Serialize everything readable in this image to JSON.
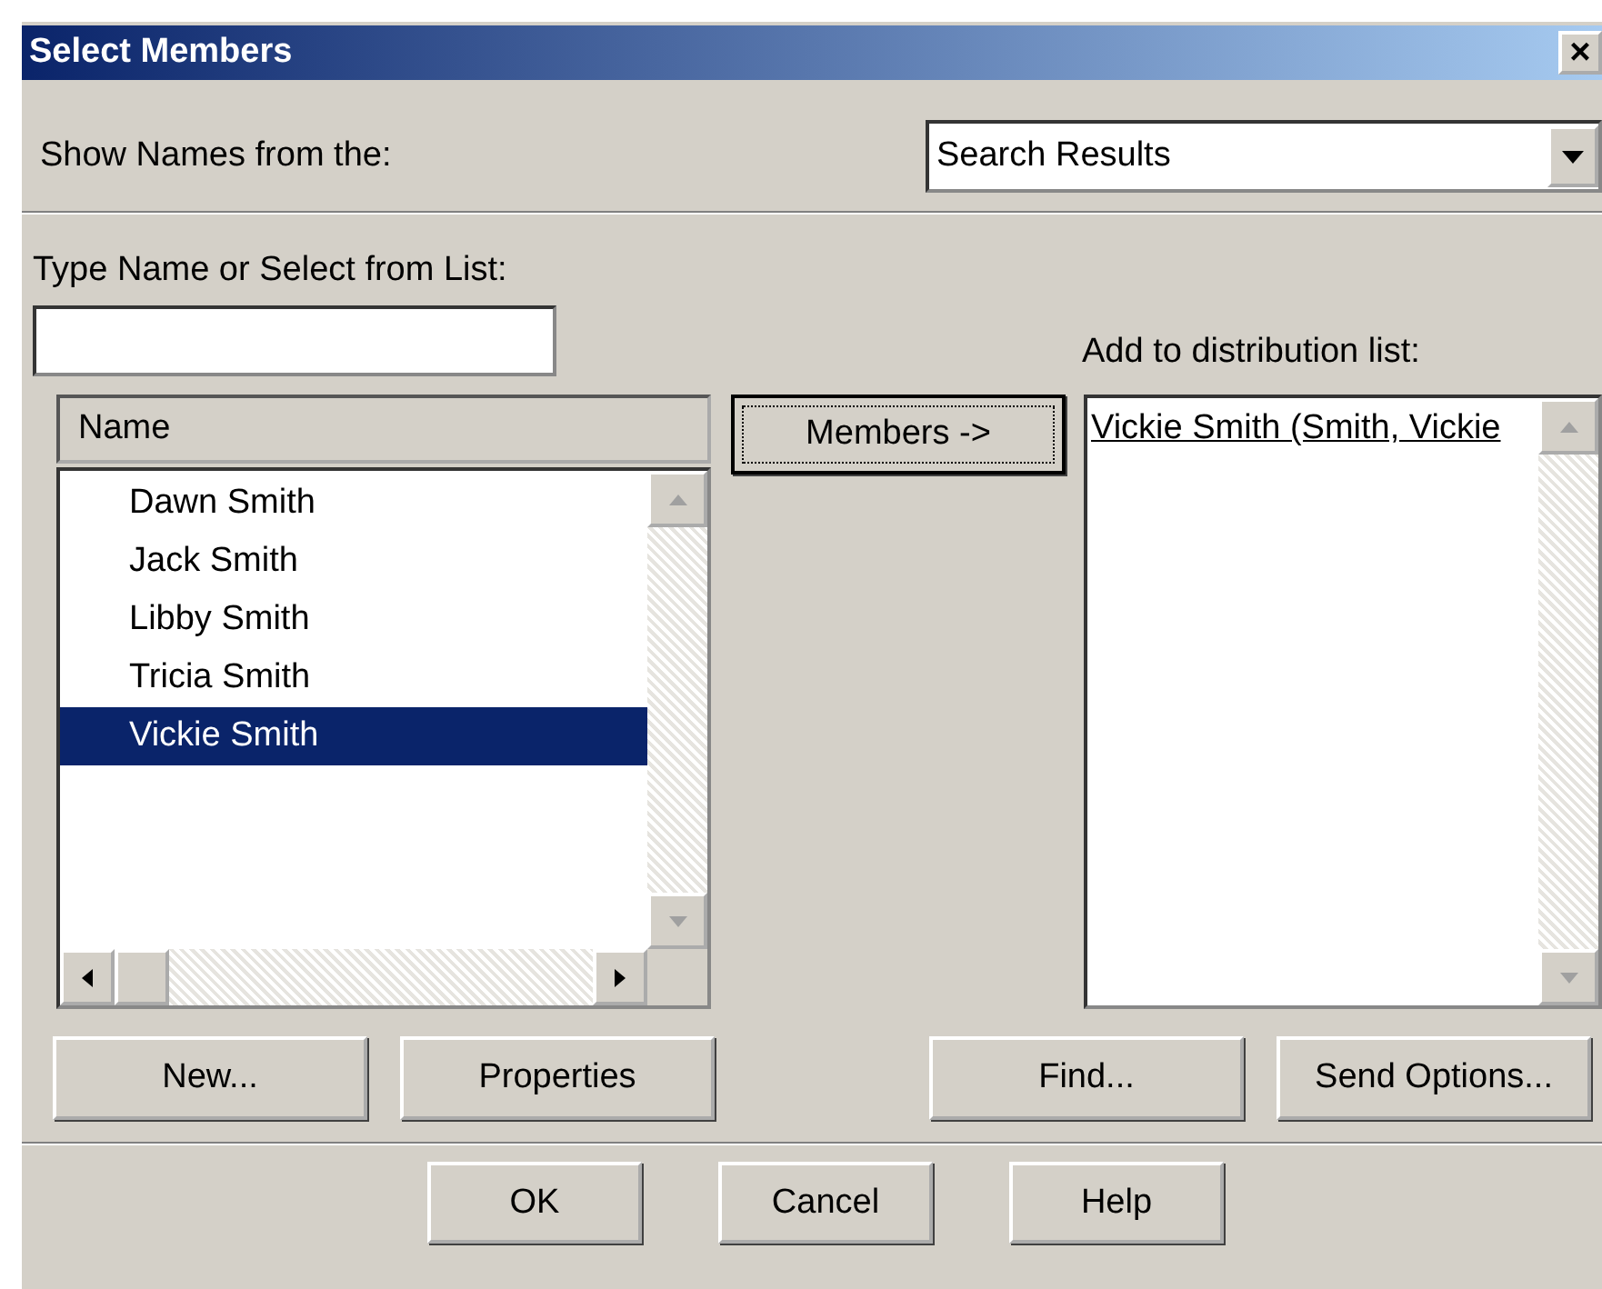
{
  "window": {
    "title": "Select Members",
    "close": "×"
  },
  "show_names": {
    "label": "Show Names from the:",
    "value": "Search Results"
  },
  "type_name": {
    "label": "Type Name or Select from List:"
  },
  "names_list": {
    "column": "Name",
    "rows": [
      {
        "name": "Dawn Smith",
        "selected": false
      },
      {
        "name": "Jack Smith",
        "selected": false
      },
      {
        "name": "Libby Smith",
        "selected": false
      },
      {
        "name": "Tricia Smith",
        "selected": false
      },
      {
        "name": "Vickie Smith",
        "selected": true
      }
    ]
  },
  "members_button": "Members ->",
  "distribution": {
    "label": "Add to distribution list:",
    "entries": [
      "Vickie Smith (Smith, Vickie"
    ]
  },
  "action_buttons": [
    "New...",
    "Properties",
    "Find...",
    "Send Options..."
  ],
  "dialog_buttons": [
    "OK",
    "Cancel",
    "Help"
  ]
}
